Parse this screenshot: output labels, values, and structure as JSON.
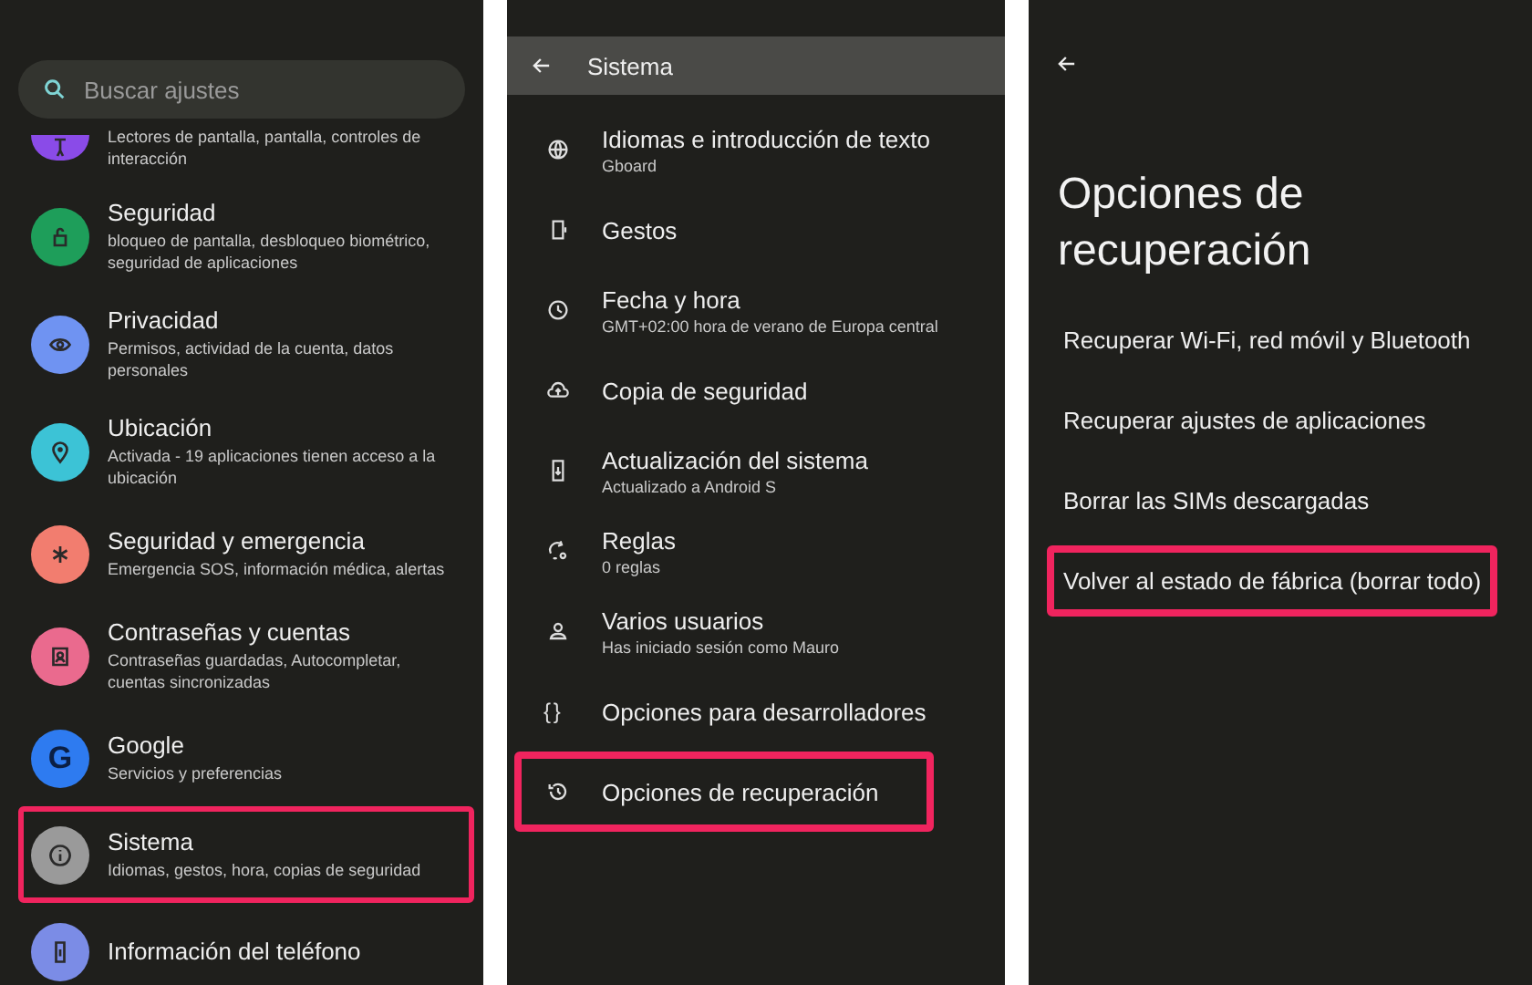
{
  "settings_panel": {
    "search": {
      "placeholder": "Buscar ajustes"
    },
    "items": [
      {
        "subtitle": "Lectores de pantalla, pantalla, controles de interacción",
        "color": "#8a4be8",
        "highlighted": false
      },
      {
        "title": "Seguridad",
        "subtitle": "bloqueo de pantalla, desbloqueo biométrico, seguridad de aplicaciones",
        "color": "#1e9e5a",
        "highlighted": false
      },
      {
        "title": "Privacidad",
        "subtitle": "Permisos, actividad de la cuenta, datos personales",
        "color": "#6f93f2",
        "highlighted": false
      },
      {
        "title": "Ubicación",
        "subtitle": "Activada - 19 aplicaciones tienen acceso a la ubicación",
        "color": "#3cc3d6",
        "highlighted": false
      },
      {
        "title": "Seguridad y emergencia",
        "subtitle": "Emergencia SOS, información médica, alertas",
        "color": "#f27d6f",
        "highlighted": false
      },
      {
        "title": "Contraseñas y cuentas",
        "subtitle": "Contraseñas guardadas, Autocompletar, cuentas sincronizadas",
        "color": "#ea6a8e",
        "highlighted": false
      },
      {
        "title": "Google",
        "subtitle": "Servicios y preferencias",
        "color": "#2e7bf0",
        "badge": "G",
        "highlighted": false
      },
      {
        "title": "Sistema",
        "subtitle": "Idiomas, gestos, hora, copias de seguridad",
        "color": "#9a9a9a",
        "highlighted": true
      },
      {
        "title": "Información del teléfono",
        "color": "#7b8ce6",
        "highlighted": false
      }
    ]
  },
  "system_panel": {
    "title": "Sistema",
    "items": [
      {
        "title": "Idiomas e introducción de texto",
        "subtitle": "Gboard",
        "highlighted": false
      },
      {
        "title": "Gestos",
        "highlighted": false
      },
      {
        "title": "Fecha y hora",
        "subtitle": "GMT+02:00 hora de verano de Europa central",
        "highlighted": false
      },
      {
        "title": "Copia de seguridad",
        "highlighted": false
      },
      {
        "title": "Actualización del sistema",
        "subtitle": "Actualizado a Android S",
        "highlighted": false
      },
      {
        "title": "Reglas",
        "subtitle": "0 reglas",
        "highlighted": false
      },
      {
        "title": "Varios usuarios",
        "subtitle": "Has iniciado sesión como Mauro",
        "highlighted": false
      },
      {
        "title": "Opciones para desarrolladores",
        "glyph": "{ }",
        "highlighted": false
      },
      {
        "title": "Opciones de recuperación",
        "highlighted": true
      }
    ]
  },
  "recovery_panel": {
    "title": "Opciones de recuperación",
    "options": [
      {
        "label": "Recuperar Wi-Fi, red móvil y Bluetooth",
        "highlighted": false
      },
      {
        "label": "Recuperar ajustes de aplicaciones",
        "highlighted": false
      },
      {
        "label": "Borrar las SIMs descargadas",
        "highlighted": false
      },
      {
        "label": "Volver al estado de fábrica (borrar todo)",
        "highlighted": true
      }
    ]
  }
}
